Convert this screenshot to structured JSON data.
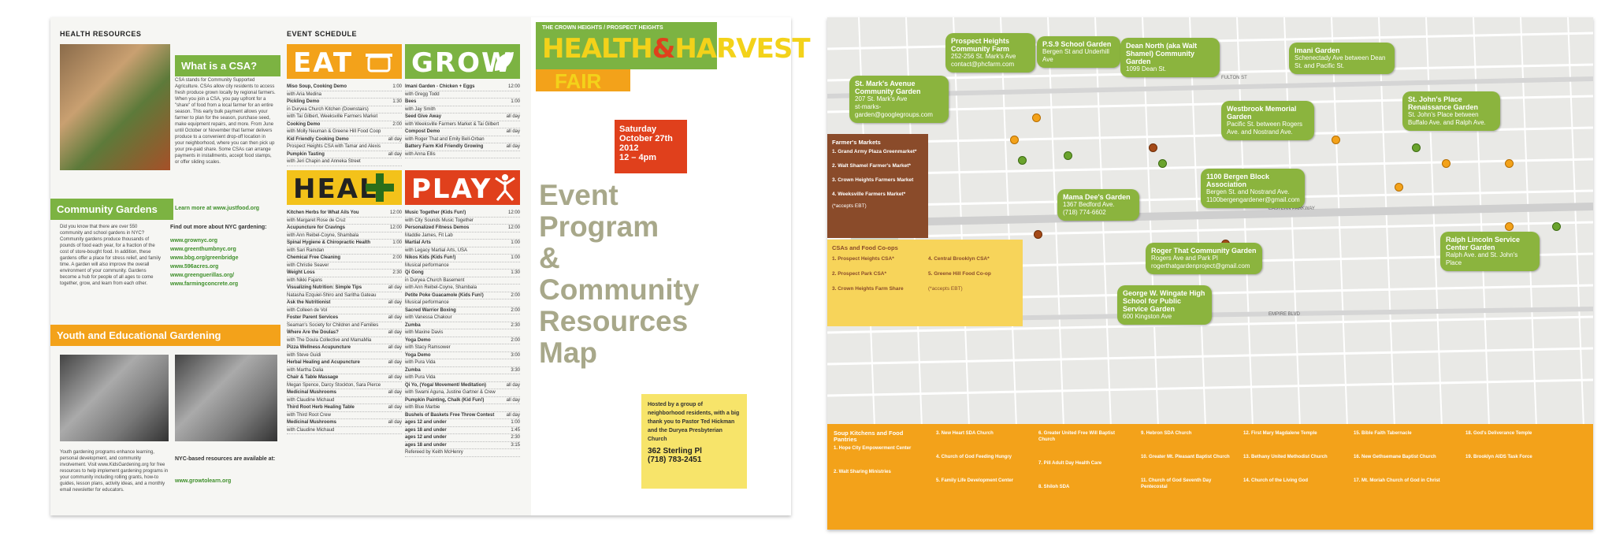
{
  "brochure": {
    "health_resources": {
      "header": "HEALTH RESOURCES",
      "csa_title": "What is a CSA?",
      "csa_text": "CSA stands for Community Supported Agriculture. CSAs allow city residents to access fresh produce grown locally by regional farmers. When you join a CSA, you pay upfront for a \"share\" of food from a local farmer for an entire season. This early bulk payment allows your farmer to plan for the season, purchase seed, make equipment repairs, and more. From June until October or November that farmer delivers produce to a convenient drop-off location in your neighborhood, where you can then pick up your pre-paid share. Some CSAs can arrange payments in installments, accept food stamps, or offer sliding scales.",
      "csa_link": "Learn more at www.justfood.org",
      "cg_title": "Community Gardens",
      "cg_text": "Did you know that there are over 550 community and school gardens in NYC? Community gardens produce thousands of pounds of food each year, for a fraction of the cost of store-bought food. In addition, these gardens offer a place for stress relief, and family time. A garden will also improve the overall environment of your community. Gardens become a hub for people of all ages to come together, grow, and learn from each other.",
      "cg_find": "Find out more about NYC gardening:",
      "cg_links": [
        "www.grownyc.org",
        "www.greenthumbnyc.org",
        "www.bbg.org/greenbridge",
        "www.596acres.org",
        "www.greenguerillas.org/",
        "www.farmingconcrete.org"
      ],
      "youth_title": "Youth and Educational Gardening",
      "youth_text": "Youth gardening programs enhance learning, personal development, and community involvement. Visit www.KidsGardening.org for free resources to help implement gardening programs in your community including rolling grants, how-to guides, lesson plans, activity ideas, and a monthly email newsletter for educators.",
      "youth_available": "NYC-based resources are available at:",
      "youth_link": "www.growtolearn.org"
    },
    "schedule": {
      "header": "EVENT SCHEDULE",
      "eat_label": "EAT",
      "grow_label": "GROW",
      "heal_label": "HEAL",
      "play_label": "PLAY",
      "eat": [
        {
          "t": "Miso Soup, Cooking Demo",
          "time": "1:00"
        },
        {
          "t": "with Aria Medina",
          "time": ""
        },
        {
          "t": "Pickling Demo",
          "time": "1:30"
        },
        {
          "t": "in Duryea Church Kitchen (Downstairs)",
          "time": ""
        },
        {
          "t": "with Tai Gilbert, Weeksville Farmers Market",
          "time": ""
        },
        {
          "t": "Cooking Demo",
          "time": "2:00"
        },
        {
          "t": "with Molly Neuman & Greene Hill Food Coop",
          "time": ""
        },
        {
          "t": "Kid Friendly Cooking Demo",
          "time": "all day"
        },
        {
          "t": "Prospect Heights CSA with Tamar and Alexis",
          "time": ""
        },
        {
          "t": "Pumpkin Tasting",
          "time": "all day"
        },
        {
          "t": "with Jeri Chapin and Anneka Street",
          "time": ""
        }
      ],
      "grow": [
        {
          "t": "Imani Garden - Chicken + Eggs",
          "time": "12:00"
        },
        {
          "t": "with Gregg Todd",
          "time": ""
        },
        {
          "t": "Bees",
          "time": "1:00"
        },
        {
          "t": "with Jay Smith",
          "time": ""
        },
        {
          "t": "Seed Give Away",
          "time": "all day"
        },
        {
          "t": "with Weeksville Farmers Market & Tai Gilbert",
          "time": ""
        },
        {
          "t": "Compost Demo",
          "time": "all day"
        },
        {
          "t": "with Roger That and Emily Bell-Orban",
          "time": ""
        },
        {
          "t": "Battery Farm Kid Friendly Growing",
          "time": "all day"
        },
        {
          "t": "with Anna Ellis",
          "time": ""
        }
      ],
      "heal": [
        {
          "t": "Kitchen Herbs for What Ails You",
          "time": "12:00"
        },
        {
          "t": "with Margaret Rose de Cruz",
          "time": ""
        },
        {
          "t": "Acupuncture for Cravings",
          "time": "12:00"
        },
        {
          "t": "with Ann Reibel-Coyne, Shambala",
          "time": ""
        },
        {
          "t": "Spinal Hygiene & Chiropractic Health",
          "time": "1:00"
        },
        {
          "t": "with Sari Ramdan",
          "time": ""
        },
        {
          "t": "Chemical Free Cleaning",
          "time": "2:00"
        },
        {
          "t": "with Christie Seaver",
          "time": ""
        },
        {
          "t": "Weight Loss",
          "time": "2:30"
        },
        {
          "t": "with Nikki Fajans",
          "time": ""
        },
        {
          "t": "Visualizing Nutrition: Simple Tips",
          "time": "all day"
        },
        {
          "t": "Natasha Ezquiel-Shiro and Saritha Gateau",
          "time": ""
        },
        {
          "t": "Ask the Nutritionist",
          "time": "all day"
        },
        {
          "t": "with Colleen de Vol",
          "time": ""
        },
        {
          "t": "Foster Parent Services",
          "time": "all day"
        },
        {
          "t": "Seaman's Society for Children and Families",
          "time": ""
        },
        {
          "t": "Where Are the Doulas?",
          "time": "all day"
        },
        {
          "t": "with The Doula Collective and MamaMia",
          "time": ""
        },
        {
          "t": "Pizza Wellness Acupuncture",
          "time": "all day"
        },
        {
          "t": "with Steve Guidi",
          "time": ""
        },
        {
          "t": "Herbal Healing and Acupuncture",
          "time": "all day"
        },
        {
          "t": "with Martha Dalia",
          "time": ""
        },
        {
          "t": "Chair & Table Massage",
          "time": "all day"
        },
        {
          "t": "Megan Spence, Darcy Stockton, Sara Pierce",
          "time": ""
        },
        {
          "t": "Medicinal Mushrooms",
          "time": "all day"
        },
        {
          "t": "with Claudine Michaud",
          "time": ""
        },
        {
          "t": "Third Root Herb Healing Table",
          "time": "all day"
        },
        {
          "t": "with Third Root Crew",
          "time": ""
        },
        {
          "t": "Medicinal Mushrooms",
          "time": "all day"
        },
        {
          "t": "with Claudine Michaud",
          "time": ""
        }
      ],
      "play": [
        {
          "t": "Music Together (Kids Fun!)",
          "time": "12:00"
        },
        {
          "t": "with City Sounds Music Together",
          "time": ""
        },
        {
          "t": "Personalized Fitness Demos",
          "time": "12:00"
        },
        {
          "t": "Maddie James, Fit Lab",
          "time": ""
        },
        {
          "t": "Martial Arts",
          "time": "1:00"
        },
        {
          "t": "with Legacy Martial Arts, USA",
          "time": ""
        },
        {
          "t": "Nikos Kids (Kids Fun!)",
          "time": "1:00"
        },
        {
          "t": "Musical performance",
          "time": ""
        },
        {
          "t": "Qi Gong",
          "time": "1:30"
        },
        {
          "t": "in Duryea Church Basement",
          "time": ""
        },
        {
          "t": "with Ann Reibel-Coyne, Shambala",
          "time": ""
        },
        {
          "t": "Petite Poke Guacamole (Kids Fun!)",
          "time": "2:00"
        },
        {
          "t": "Musical performance",
          "time": ""
        },
        {
          "t": "Sacred Warrior Boxing",
          "time": "2:00"
        },
        {
          "t": "with Vanessa Chakour",
          "time": ""
        },
        {
          "t": "Zumba",
          "time": "2:30"
        },
        {
          "t": "with Maxine Davis",
          "time": ""
        },
        {
          "t": "Yoga Demo",
          "time": "2:00"
        },
        {
          "t": "with Stacy Ramsower",
          "time": ""
        },
        {
          "t": "Yoga Demo",
          "time": "3:00"
        },
        {
          "t": "with Pura Vida",
          "time": ""
        },
        {
          "t": "Zumba",
          "time": "3:30"
        },
        {
          "t": "with Pura Vida",
          "time": ""
        },
        {
          "t": "Qi Yo, (Yoga/ Movement/ Meditation)",
          "time": "all day"
        },
        {
          "t": "with Swami Aguna, Justine Gartner & Crew",
          "time": ""
        },
        {
          "t": "Pumpkin Painting, Chalk (Kid Fun!)",
          "time": "all day"
        },
        {
          "t": "with Blue Marbie",
          "time": ""
        },
        {
          "t": "Bushels of Baskets Free Throw Contest",
          "time": "all day"
        },
        {
          "t": "ages 12 and under",
          "time": "1:00"
        },
        {
          "t": "ages 18 and under",
          "time": "1:45"
        },
        {
          "t": "ages 12 and under",
          "time": "2:30"
        },
        {
          "t": "ages 18 and under",
          "time": "3:15"
        },
        {
          "t": "Refereed by Keith McHenry",
          "time": ""
        }
      ]
    },
    "cover": {
      "top_line": "THE CROWN HEIGHTS / PROSPECT HEIGHTS",
      "title_1": "HEALTH",
      "title_amp": "&",
      "title_2": "HARVEST",
      "fair": "FAIR",
      "date_1": "Saturday",
      "date_2": "October 27th 2012",
      "time": "12 – 4pm",
      "program_lines": [
        "Event",
        "Program",
        "&",
        "Community",
        "Resources",
        "Map"
      ],
      "host_text": "Hosted by a group of neighborhood residents, with a big thank you to Pastor Ted Hickman and the Duryea Presbyterian Church",
      "address": "362 Sterling Pl",
      "phone": "(718) 783-2451"
    }
  },
  "map": {
    "gardens": [
      {
        "name": "Prospect Heights Community Farm",
        "line": "252-256 St. Mark's Ave",
        "line2": "contact@phcfarm.com"
      },
      {
        "name": "P.S.9 School Garden",
        "line": "Bergen St and Underhill Ave",
        "line2": ""
      },
      {
        "name": "Dean North (aka Walt Shamel) Community Garden",
        "line": "1099 Dean St.",
        "line2": ""
      },
      {
        "name": "Imani Garden",
        "line": "Schenectady Ave between Dean St. and Pacific St.",
        "line2": ""
      },
      {
        "name": "St. Mark's Avenue Community Garden",
        "line": "207 St. Mark's Ave",
        "line2": "st-marks-garden@googlegroups.com"
      },
      {
        "name": "Westbrook Memorial Garden",
        "line": "Pacific St. between Rogers Ave. and Nostrand Ave.",
        "line2": ""
      },
      {
        "name": "St. John's Place Renaissance Garden",
        "line": "St. John's Place between Buffalo Ave. and Ralph Ave.",
        "line2": ""
      },
      {
        "name": "1100 Bergen Block Association",
        "line": "Bergen St. and Nostrand Ave.",
        "line2": "1100bergengardener@gmail.com"
      },
      {
        "name": "Mama Dee's Garden",
        "line": "1367 Bedford Ave.",
        "line2": "(718) 774-6602"
      },
      {
        "name": "Roger That Community Garden",
        "line": "Rogers Ave and Park Pl",
        "line2": "rogerthatgardenproject@gmail.com"
      },
      {
        "name": "Ralph Lincoln Service Center Garden",
        "line": "Ralph Ave. and St. John's Place",
        "line2": ""
      },
      {
        "name": "George W. Wingate High School for Public Service Garden",
        "line": "600 Kingston Ave",
        "line2": ""
      }
    ],
    "farmers_markets": {
      "title": "Farmer's Markets",
      "items": [
        "1. Grand Army Plaza Greenmarket*",
        "2. Walt Shamel Farmer's Market*",
        "3. Crown Heights Farmers Market",
        "4. Weeksville Farmers Market*"
      ],
      "note": "(*accepts EBT)"
    },
    "csa": {
      "title": "CSAs and Food Co-ops",
      "items": [
        "1. Prospect Heights CSA*",
        "2. Prospect Park CSA*",
        "3. Crown Heights Farm Share",
        "4. Central Brooklyn CSA*",
        "5. Greene Hill Food Co-op"
      ],
      "note": "(*accepts EBT)"
    },
    "pantries": {
      "title": "Soup Kitchens and Food Pantries",
      "items": [
        "1. Hope City Empowerment Center",
        "2. Walt Sharing Ministries",
        "3. New Heart SDA Church",
        "4. Church of God Feeding Hungry",
        "5. Family Life Development Center",
        "6. Greater United Free Will Baptist Church",
        "7. Pill Adult Day Health Care",
        "8. Shiloh SDA",
        "9. Hebron SDA Church",
        "10. Greater Mt. Pleasant Baptist Church",
        "11. Church of God Seventh Day Pentecostal",
        "12. First Mary Magdalene Temple",
        "13. Bethany United Methodist Church",
        "14. Church of the Living God",
        "15. Bible Faith Tabernacle",
        "16. New Gethsemane Baptist Church",
        "17. Mt. Moriah Church of God in Christ",
        "18. God's Deliverance Temple",
        "19. Brooklyn AIDS Task Force"
      ]
    },
    "streets": [
      "FULTON ST",
      "EASTERN PARKWAY",
      "EMPIRE BLVD"
    ]
  },
  "colors": {
    "green": "#7cb342",
    "orange": "#f3a21a",
    "red": "#e0401c",
    "brown": "#8a4b2a",
    "olive": "#a8a88a"
  }
}
